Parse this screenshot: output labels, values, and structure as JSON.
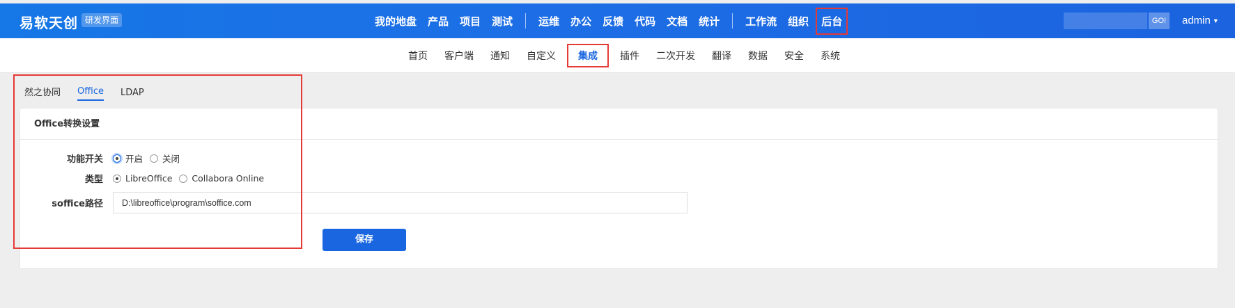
{
  "header": {
    "brand": "易软天创",
    "brand_tag": "研发界面",
    "nav_left": [
      "我的地盘",
      "产品",
      "项目",
      "测试"
    ],
    "nav_mid": [
      "运维",
      "办公",
      "反馈",
      "代码",
      "文档",
      "统计"
    ],
    "nav_right": [
      "工作流",
      "组织"
    ],
    "nav_active": "后台",
    "search_placeholder": "",
    "go_label": "GO!",
    "user": "admin"
  },
  "subnav": {
    "items": [
      "首页",
      "客户端",
      "通知",
      "自定义"
    ],
    "active": "集成",
    "items_after": [
      "插件",
      "二次开发",
      "翻译",
      "数据",
      "安全",
      "系统"
    ]
  },
  "tabs": [
    "然之协同",
    "Office",
    "LDAP"
  ],
  "active_tab": "Office",
  "panel": {
    "title": "Office转换设置",
    "switch_label": "功能开关",
    "switch_on": "开启",
    "switch_off": "关闭",
    "switch_value": "开启",
    "type_label": "类型",
    "type_libre": "LibreOffice",
    "type_collabora": "Collabora Online",
    "type_value": "LibreOffice",
    "path_label": "soffice路径",
    "path_value": "D:\\libreoffice\\program\\soffice.com",
    "save_label": "保存"
  },
  "colors": {
    "primary": "#1a66e0",
    "highlight": "#e53935",
    "header_bg": "#1b6fe4"
  }
}
